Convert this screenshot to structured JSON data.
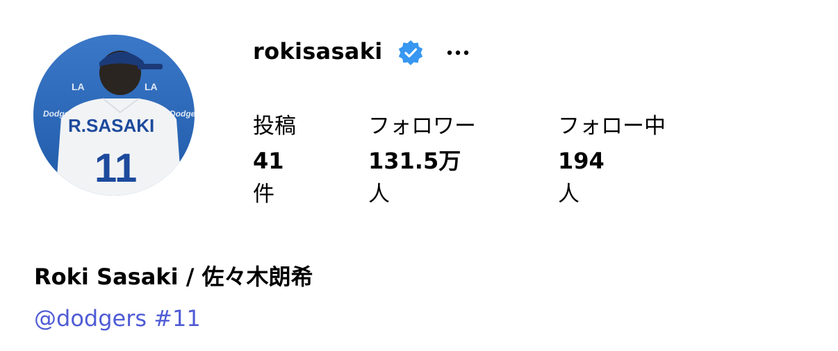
{
  "profile": {
    "username": "rokisasaki",
    "verified_icon": "verified-badge-icon",
    "more_icon": "more-options-icon",
    "avatar_icon": "profile-photo-avatar",
    "verified_color": "#3897f0",
    "link_color": "#4f5bd5"
  },
  "stats": {
    "posts": {
      "label": "投稿",
      "value": "41",
      "unit": "件"
    },
    "followers": {
      "label": "フォロワー",
      "value": "131.5万",
      "unit": "人"
    },
    "following": {
      "label": "フォロー中",
      "value": "194",
      "unit": "人"
    }
  },
  "bio": {
    "display_name": "Roki Sasaki / 佐々木朗希",
    "mention": "@dodgers",
    "hashtag": "#11"
  },
  "avatar": {
    "jersey_name": "R.SASAKI",
    "jersey_number": "11"
  }
}
